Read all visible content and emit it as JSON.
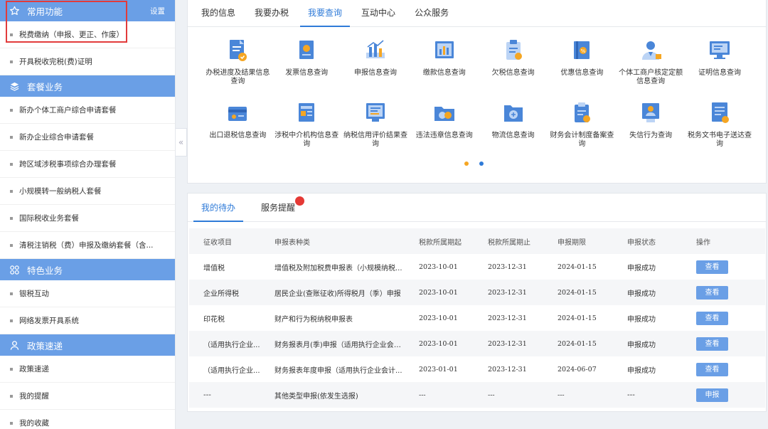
{
  "sidebar": {
    "sections": [
      {
        "title": "常用功能",
        "icon": "star-icon",
        "settings": "设置",
        "items": [
          "税费缴纳（申报、更正、作废）",
          "开具税收完税(费)证明"
        ]
      },
      {
        "title": "套餐业务",
        "icon": "layers-icon",
        "items": [
          "新办个体工商户综合申请套餐",
          "新办企业综合申请套餐",
          "跨区域涉税事项综合办理套餐",
          "小规模转一般纳税人套餐",
          "国际税收业务套餐",
          "清税注销税（费）申报及缴纳套餐（含..."
        ]
      },
      {
        "title": "特色业务",
        "icon": "grid-icon",
        "items": [
          "银税互动",
          "网络发票开具系统"
        ]
      },
      {
        "title": "政策速递",
        "icon": "person-icon",
        "items": [
          "政策速递",
          "我的提醒",
          "我的收藏"
        ]
      }
    ]
  },
  "collapse_glyph": "«",
  "top_tabs": [
    "我的信息",
    "我要办税",
    "我要查询",
    "互动中心",
    "公众服务"
  ],
  "top_active": 2,
  "query_items": [
    {
      "label": "办税进度及结果信息查询",
      "icon": "doc-progress-icon"
    },
    {
      "label": "发票信息查询",
      "icon": "invoice-icon"
    },
    {
      "label": "申报信息查询",
      "icon": "declaration-chart-icon"
    },
    {
      "label": "缴款信息查询",
      "icon": "payment-chart-icon"
    },
    {
      "label": "欠税信息查询",
      "icon": "clipboard-icon"
    },
    {
      "label": "优惠信息查询",
      "icon": "discount-book-icon"
    },
    {
      "label": "个体工商户核定定额信息查询",
      "icon": "business-person-icon"
    },
    {
      "label": "证明信息查询",
      "icon": "certificate-monitor-icon"
    },
    {
      "label": "出口退税信息查询",
      "icon": "export-card-icon"
    },
    {
      "label": "涉税中介机构信息查询",
      "icon": "agency-doc-icon"
    },
    {
      "label": "纳税信用评价结果查询",
      "icon": "credit-screen-icon"
    },
    {
      "label": "违法违章信息查询",
      "icon": "violation-folder-icon"
    },
    {
      "label": "物流信息查询",
      "icon": "logistics-folder-icon"
    },
    {
      "label": "财务会计制度备案查询",
      "icon": "accounting-clipboard-icon"
    },
    {
      "label": "失信行为查询",
      "icon": "badge-person-icon"
    },
    {
      "label": "税务文书电子送达查询",
      "icon": "document-delivery-icon"
    }
  ],
  "pager_colors": [
    "#f5a623",
    "#2f7bd8"
  ],
  "bottom_tabs": [
    "我的待办",
    "服务提醒"
  ],
  "bottom_active": 0,
  "table": {
    "columns": [
      "征收项目",
      "申报表种类",
      "税款所属期起",
      "税款所属期止",
      "申报期限",
      "申报状态",
      "操作"
    ],
    "rows": [
      [
        "增值税",
        "增值税及附加税费申报表（小规模纳税...",
        "2023-10-01",
        "2023-12-31",
        "2024-01-15",
        "申报成功",
        "查看"
      ],
      [
        "企业所得税",
        "居民企业(查账征收)所得税月（季）申报",
        "2023-10-01",
        "2023-12-31",
        "2024-01-15",
        "申报成功",
        "查看"
      ],
      [
        "印花税",
        "财产和行为税纳税申报表",
        "2023-10-01",
        "2023-12-31",
        "2024-01-15",
        "申报成功",
        "查看"
      ],
      [
        "（适用执行企业...",
        "财务报表月(季)申报（适用执行企业会计...",
        "2023-10-01",
        "2023-12-31",
        "2024-01-15",
        "申报成功",
        "查看"
      ],
      [
        "（适用执行企业...",
        "财务报表年度申报（适用执行企业会计...",
        "2023-01-01",
        "2023-12-31",
        "2024-06-07",
        "申报成功",
        "查看"
      ],
      [
        "---",
        "其他类型申报(依发生选报)",
        "---",
        "---",
        "---",
        "---",
        "申报"
      ]
    ]
  },
  "colors": {
    "accent": "#2f7bd8",
    "section_header": "#6a9fe6",
    "alert": "#e53935",
    "highlight": "#e23b3b"
  }
}
